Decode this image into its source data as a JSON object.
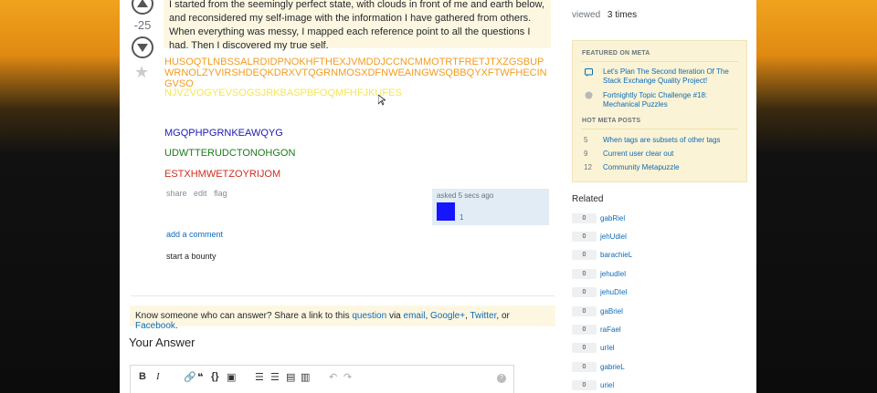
{
  "question": {
    "score": "-25",
    "body": "I started from the seemingly perfect state, with clouds in front of me and earth below, and reconsidered my self-image with the information I have gathered from others. When everything was messy, I mapped each reference point to all the questions I had. Then I discovered my true self.",
    "line_orange": "HUSOQTLNBSSALRDIDPNOKHFTHEXJVMDDJCCNCMMOTRTFRETJTXZGSBUPWRNOLZYVIRSHDEQKDRXVTQGRNMOSXDFNWEAINGWSQBBQYXFTWFHECINGVSO",
    "line_yellow": "NJVZVOGYEVSOGSJRKBASPBFOQMFHFJKUFES",
    "line_blue": "MGQPHPGRNKEAWQYG",
    "line_green": "UDWTTERUDCTONOHGON",
    "line_red": "ESTXHMWETZOYRIJOM",
    "menu": [
      "share",
      "edit",
      "flag"
    ],
    "asked_label": "asked 5 secs ago",
    "author_rep": "1",
    "add_comment": "add a comment",
    "start_bounty": "start a bounty"
  },
  "share_bar": {
    "prefix": "Know someone who can answer? Share a link to this",
    "question_link": "question",
    "via": "via",
    "email": "email",
    "google": "Google+",
    "twitter": "Twitter",
    "or": ", or",
    "facebook": "Facebook",
    "end": "."
  },
  "answer": {
    "heading": "Your Answer",
    "help": "?"
  },
  "sidebar": {
    "viewed_label": "viewed",
    "viewed_value": "3 times",
    "featured_heading": "FEATURED ON META",
    "featured": [
      "Let's Plan The Second Iteration Of The Stack Exchange Quality Project!",
      "Fortnightly Topic Challenge #18: Mechanical Puzzles"
    ],
    "hot_heading": "HOT META POSTS",
    "hot": [
      {
        "count": "5",
        "title": "When tags are subsets of other tags"
      },
      {
        "count": "9",
        "title": "Current user clear out"
      },
      {
        "count": "12",
        "title": "Community Metapuzzle"
      }
    ],
    "related_heading": "Related",
    "related": [
      {
        "score": "0",
        "title": "gabRiel"
      },
      {
        "score": "0",
        "title": "jehUdiel"
      },
      {
        "score": "0",
        "title": "barachieL"
      },
      {
        "score": "0",
        "title": "jehudIel"
      },
      {
        "score": "0",
        "title": "jehuDIel"
      },
      {
        "score": "0",
        "title": "gaBriel"
      },
      {
        "score": "0",
        "title": "raFael"
      },
      {
        "score": "0",
        "title": "urIel"
      },
      {
        "score": "0",
        "title": "gabrieL"
      },
      {
        "score": "0",
        "title": "uriel"
      }
    ]
  },
  "colors": {
    "link": "#0c6bb8",
    "notice_bg": "#fdf7e2",
    "meta_bg": "#fbf3d5",
    "avatar": "#1515ff"
  }
}
